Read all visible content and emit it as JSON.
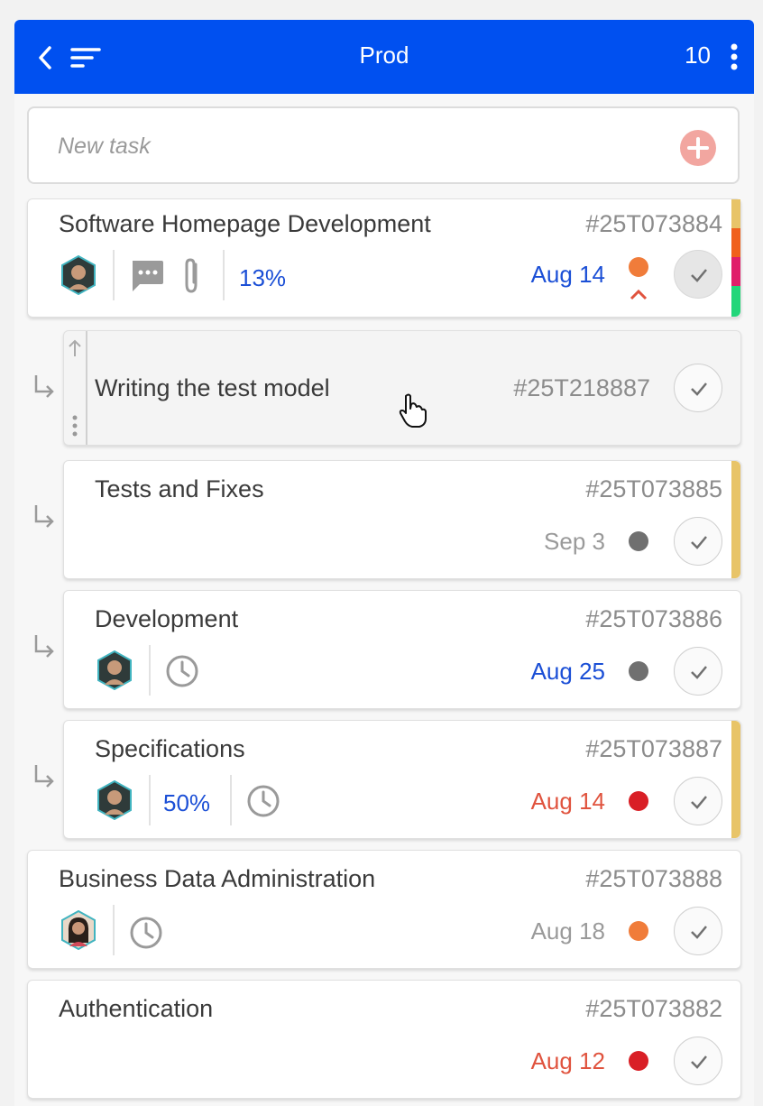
{
  "header": {
    "title": "Prod",
    "count": "10",
    "icons": [
      "chevron-left-icon",
      "sort-icon",
      "more-vertical-icon"
    ]
  },
  "new_task": {
    "placeholder": "New task"
  },
  "tasks": [
    {
      "title": "Software Homepage Development",
      "id": "#25T073884",
      "date": "Aug 14",
      "progress": "13%",
      "priority_color": "#f07c3a",
      "stripe_colors": [
        "#e8c468",
        "#f0601c",
        "#e01e6a",
        "#22d67a"
      ]
    },
    {
      "title": "Writing the test model",
      "id": "#25T218887"
    },
    {
      "title": "Tests and Fixes",
      "id": "#25T073885",
      "date": "Sep 3",
      "priority_color": "#707070",
      "stripe_colors": [
        "#e8c468"
      ]
    },
    {
      "title": "Development",
      "id": "#25T073886",
      "date": "Aug 25",
      "priority_color": "#707070"
    },
    {
      "title": "Specifications",
      "id": "#25T073887",
      "date": "Aug 14",
      "progress": "50%",
      "priority_color": "#d91f26",
      "stripe_colors": [
        "#e8c468"
      ]
    },
    {
      "title": "Business Data Administration",
      "id": "#25T073888",
      "date": "Aug 18",
      "priority_color": "#f07c3a"
    },
    {
      "title": "Authentication",
      "id": "#25T073882",
      "date": "Aug 12",
      "priority_color": "#d91f26"
    }
  ]
}
